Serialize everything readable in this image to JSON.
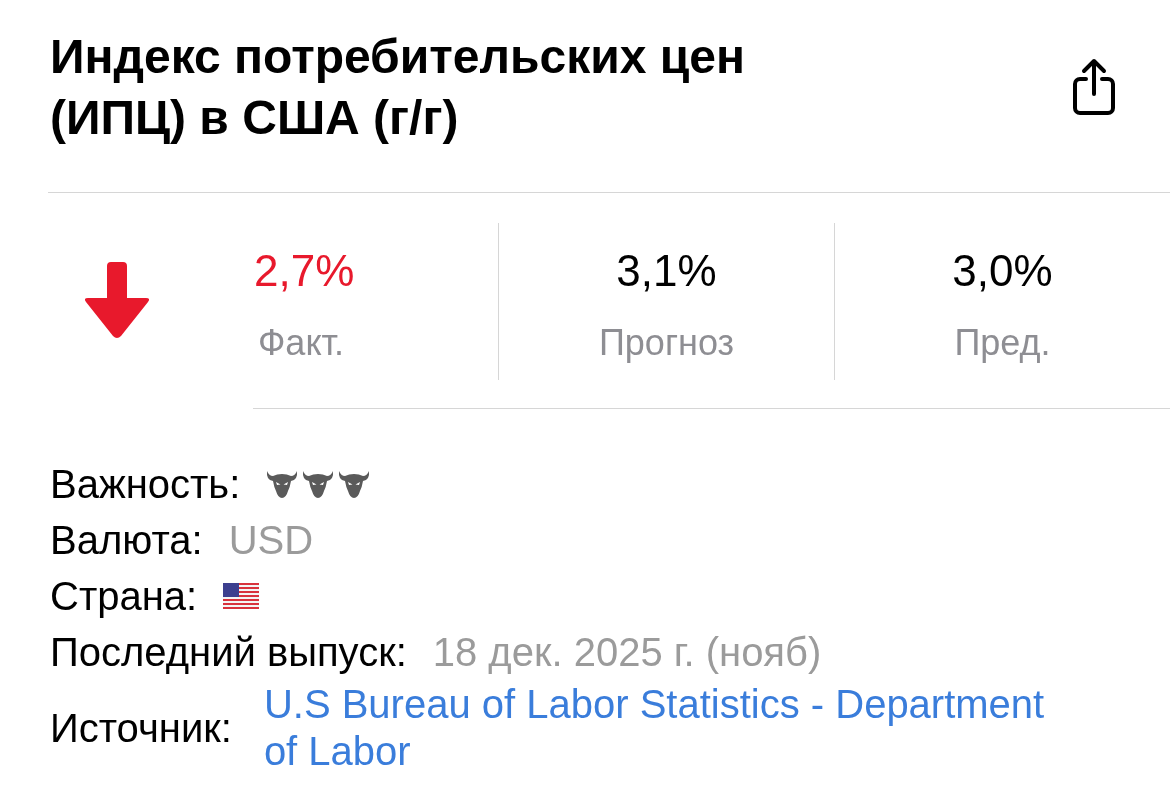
{
  "header": {
    "title": "Индекс потребительских цен (ИПЦ) в США (г/г)"
  },
  "stats": {
    "falling": true,
    "items": [
      {
        "kind": "actual",
        "value": "2,7%",
        "label": "Факт."
      },
      {
        "kind": "forecast",
        "value": "3,1%",
        "label": "Прогноз"
      },
      {
        "kind": "previous",
        "value": "3,0%",
        "label": "Пред."
      }
    ]
  },
  "details": [
    {
      "kind": "importance",
      "label": "Важность:",
      "stars": 3
    },
    {
      "kind": "text",
      "label": "Валюта:",
      "value": "USD"
    },
    {
      "kind": "flag",
      "label": "Страна:"
    },
    {
      "kind": "text",
      "label": "Последний выпуск:",
      "value": "18 дек. 2025 г. (нояб)"
    },
    {
      "kind": "link",
      "label": "Источник:",
      "value": "U.S Bureau of Labor Statistics - Department of Labor"
    }
  ]
}
